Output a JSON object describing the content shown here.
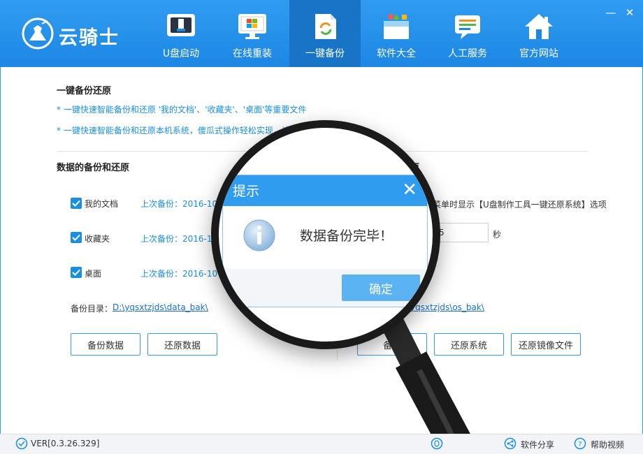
{
  "app": {
    "brand": "云骑士"
  },
  "colors": {
    "header": "#2f9cf0",
    "header_active": "#1774c6",
    "accent": "#1a8fe0",
    "note_text": "#1a8fe0"
  },
  "nav": [
    {
      "label": "U盘启动",
      "icon": "usb-drive-icon"
    },
    {
      "label": "在线重装",
      "icon": "windows-monitor-icon"
    },
    {
      "label": "一键备份",
      "icon": "backup-document-icon",
      "active": true
    },
    {
      "label": "软件大全",
      "icon": "software-box-icon"
    },
    {
      "label": "人工服务",
      "icon": "chat-bubble-icon"
    },
    {
      "label": "官方网站",
      "icon": "home-icon"
    }
  ],
  "window_controls": {
    "minimize": "—",
    "close": "✕"
  },
  "content": {
    "section_title": "一键备份还原",
    "note1": "* 一键快速智能备份和还原 '我的文档'、'收藏夹'、'桌面'等重要文件",
    "note2": "* 一键快速智能备份和还原本机系统，傻瓜式操作轻松实现，让",
    "data_section": {
      "title": "数据的备份和还原",
      "items": [
        {
          "label": "我的文档",
          "last_backup": "上次备份：2016-10-"
        },
        {
          "label": "收藏夹",
          "last_backup": "上次备份：2016-10"
        },
        {
          "label": "桌面",
          "last_backup": "上次备份：2016-10"
        }
      ],
      "dir_label": "备份目录：",
      "dir_path": "D:\\yqsxtzjds\\data_bak\\",
      "backup_button": "备份数据",
      "restore_button": "还原数据"
    },
    "system_section": {
      "title_partial": "原",
      "option_text": "菜单时显示【U盘制作工具一键还原系统】选项",
      "seconds_value": "5",
      "seconds_unit": "秒",
      "dir_path": "yqsxtzjds\\os_bak\\",
      "backup_button": "备份",
      "restore_button": "还原系统",
      "restore_image_button": "还原镜像文件"
    }
  },
  "dialog": {
    "title": "提示",
    "close": "✕",
    "message": "数据备份完毕！",
    "ok": "确定"
  },
  "footer": {
    "version": "VER[0.3.26.329]",
    "share": "软件分享",
    "help": "帮助视频"
  }
}
